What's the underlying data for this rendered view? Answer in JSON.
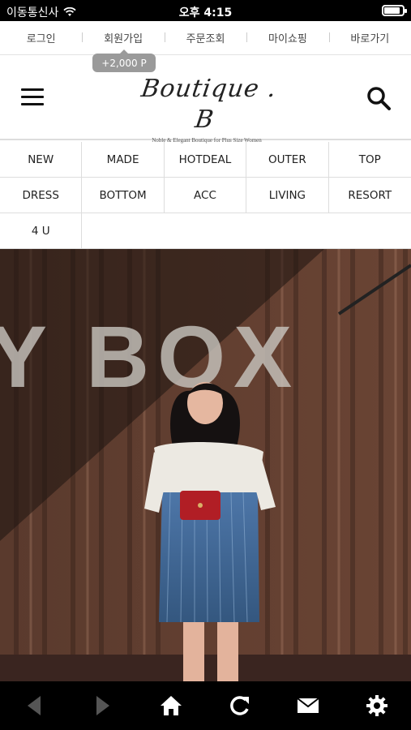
{
  "status_bar": {
    "carrier": "이동통신사",
    "time": "오후 4:15",
    "battery_level": 0.85,
    "icons": [
      "wifi-icon",
      "battery-icon"
    ]
  },
  "top_links": [
    {
      "label": "로그인"
    },
    {
      "label": "회원가입"
    },
    {
      "label": "주문조회"
    },
    {
      "label": "마이쇼핑"
    },
    {
      "label": "바로가기"
    }
  ],
  "signup_badge": "+2,000 P",
  "header": {
    "logo_text": "Boutique . B",
    "logo_tagline": "Noble & Elegant Boutique for Plus Size Women",
    "menu_icon": "hamburger-menu-icon",
    "search_icon": "search-icon"
  },
  "categories": [
    [
      "NEW",
      "MADE",
      "HOTDEAL",
      "OUTER",
      "TOP"
    ],
    [
      "DRESS",
      "BOTTOM",
      "ACC",
      "LIVING",
      "RESORT"
    ],
    [
      "4 U"
    ]
  ],
  "banner": {
    "wall_text": "Y BOX"
  },
  "toolbar": {
    "icons": [
      "back-arrow-icon",
      "forward-arrow-icon",
      "home-icon",
      "refresh-icon",
      "mail-icon",
      "settings-gear-icon"
    ]
  },
  "colors": {
    "status_bar_bg": "#000000",
    "toolbar_bg": "#000000",
    "badge_bg": "#9a9a9a",
    "container_wall": "#4a2f24"
  }
}
